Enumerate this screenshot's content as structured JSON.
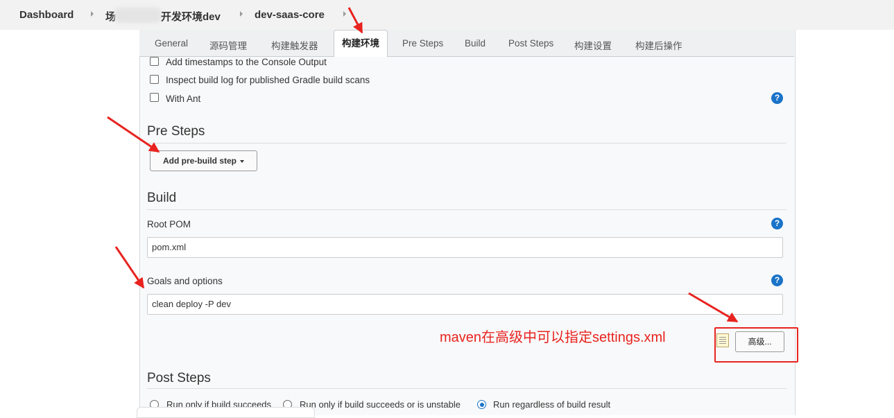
{
  "breadcrumb": {
    "items": [
      "Dashboard",
      "场",
      "开发环境dev",
      "dev-saas-core"
    ]
  },
  "tabs": [
    "General",
    "源码管理",
    "构建触发器",
    "构建环境",
    "Pre Steps",
    "Build",
    "Post Steps",
    "构建设置",
    "构建后操作"
  ],
  "env_options": [
    {
      "label": "Add timestamps to the Console Output",
      "checked": false
    },
    {
      "label": "Inspect build log for published Gradle build scans",
      "checked": false
    },
    {
      "label": "With Ant",
      "checked": false
    }
  ],
  "help_glyph": "?",
  "pre_steps": {
    "title": "Pre Steps",
    "add_button": "Add pre-build step"
  },
  "build": {
    "title": "Build",
    "root_pom_label": "Root POM",
    "root_pom_value": "pom.xml",
    "goals_label": "Goals and options",
    "goals_value": "clean deploy -P dev",
    "advanced_button": "高级..."
  },
  "annotation": "maven在高级中可以指定settings.xml",
  "post_steps": {
    "title": "Post Steps",
    "options": [
      {
        "label": "Run only if build succeeds",
        "selected": false
      },
      {
        "label": "Run only if build succeeds or is unstable",
        "selected": false
      },
      {
        "label": "Run regardless of build result",
        "selected": true
      }
    ]
  },
  "colors": {
    "annotation_red": "#e8231f",
    "help_blue": "#1a73c8"
  }
}
